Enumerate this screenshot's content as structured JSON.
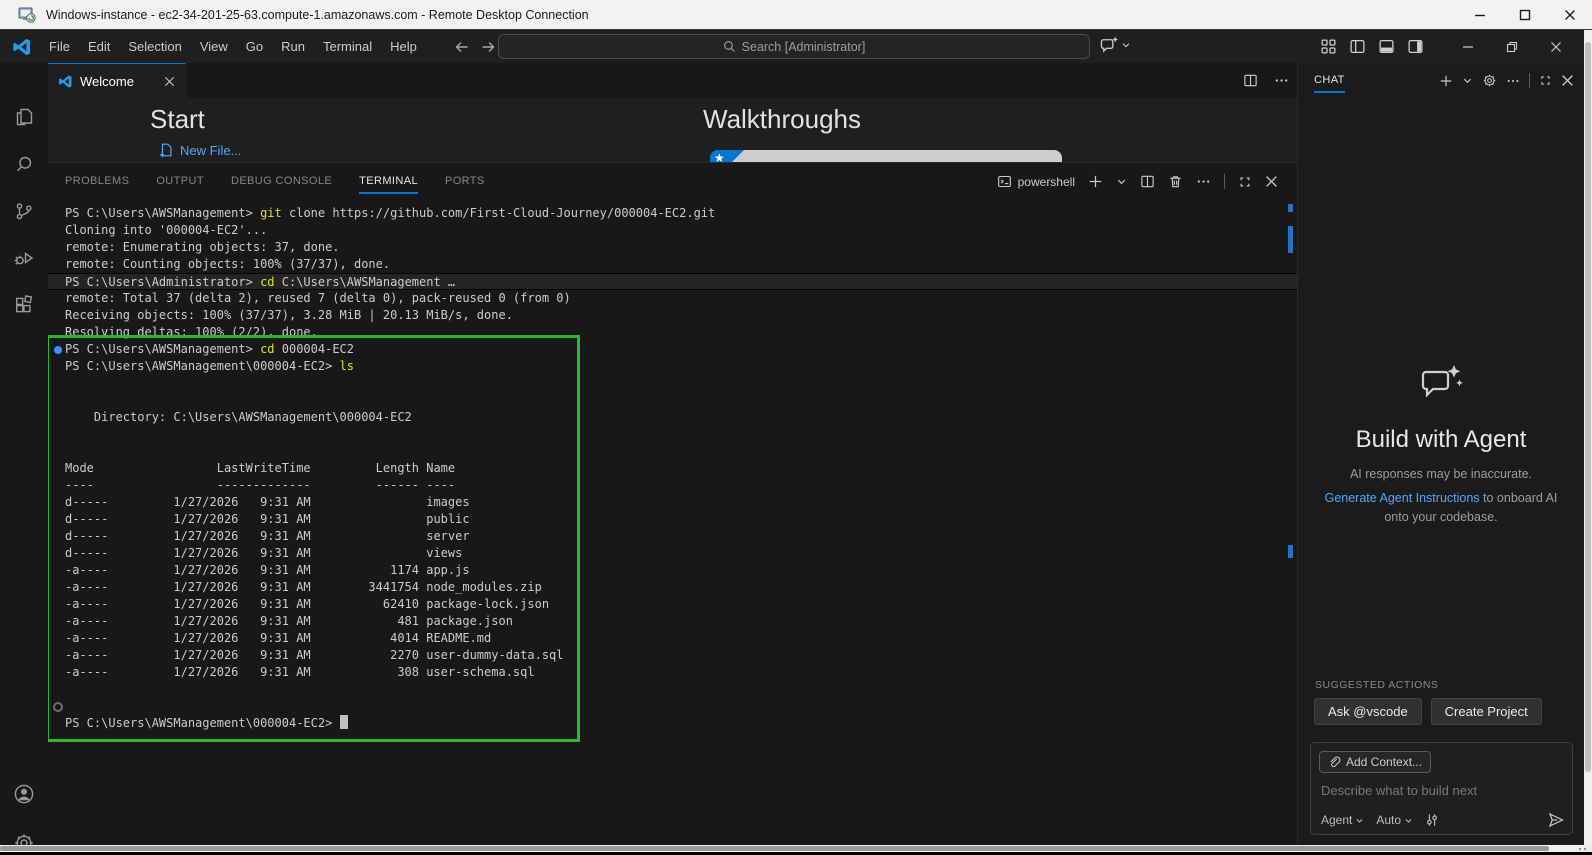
{
  "rdp": {
    "title": "Windows-instance - ec2-34-201-25-63.compute-1.amazonaws.com - Remote Desktop Connection"
  },
  "menubar": {
    "items": [
      "File",
      "Edit",
      "Selection",
      "View",
      "Go",
      "Run",
      "Terminal",
      "Help"
    ],
    "search_placeholder": "Search [Administrator]"
  },
  "editor": {
    "tab_label": "Welcome",
    "start_heading": "Start",
    "new_file_label": "New File...",
    "walkthroughs_heading": "Walkthroughs"
  },
  "panel": {
    "tabs": [
      "PROBLEMS",
      "OUTPUT",
      "DEBUG CONSOLE",
      "TERMINAL",
      "PORTS"
    ],
    "active_tab": "TERMINAL",
    "shell_label": "powershell"
  },
  "terminal": {
    "lines": [
      {
        "segs": [
          {
            "t": "PS C:\\Users\\AWSManagement> "
          },
          {
            "t": "git",
            "c": "y"
          },
          {
            "t": " clone https://github.com/First-Cloud-Journey/000004-EC2.git"
          }
        ]
      },
      {
        "segs": [
          {
            "t": "Cloning into '000004-EC2'..."
          }
        ]
      },
      {
        "segs": [
          {
            "t": "remote: Enumerating objects: 37, done."
          }
        ]
      },
      {
        "segs": [
          {
            "t": "remote: Counting objects: 100% (37/37), done."
          }
        ]
      },
      {
        "hl": true,
        "segs": [
          {
            "t": "PS C:\\Users\\Administrator> "
          },
          {
            "t": "cd",
            "c": "y"
          },
          {
            "t": " C:\\Users\\AWSManagement …"
          }
        ]
      },
      {
        "segs": [
          {
            "t": "remote: Total 37 (delta 2), reused 7 (delta 0), pack-reused 0 (from 0)"
          }
        ]
      },
      {
        "segs": [
          {
            "t": "Receiving objects: 100% (37/37), 3.28 MiB | 20.13 MiB/s, done."
          }
        ]
      },
      {
        "segs": [
          {
            "t": "Resolving deltas: 100% (2/2), done."
          }
        ]
      },
      {
        "dot": "blue",
        "segs": [
          {
            "t": "PS C:\\Users\\AWSManagement> "
          },
          {
            "t": "cd",
            "c": "y"
          },
          {
            "t": " 000004-EC2"
          }
        ]
      },
      {
        "segs": [
          {
            "t": "PS C:\\Users\\AWSManagement\\000004-EC2> "
          },
          {
            "t": "ls",
            "c": "y"
          }
        ]
      },
      {
        "segs": []
      },
      {
        "segs": []
      },
      {
        "segs": [
          {
            "t": "    Directory: C:\\Users\\AWSManagement\\000004-EC2"
          }
        ]
      },
      {
        "segs": []
      },
      {
        "segs": []
      },
      {
        "segs": [
          {
            "t": "Mode                 LastWriteTime         Length Name"
          }
        ]
      },
      {
        "segs": [
          {
            "t": "----                 -------------         ------ ----"
          }
        ]
      },
      {
        "segs": [
          {
            "t": "d-----         1/27/2026   9:31 AM                images"
          }
        ]
      },
      {
        "segs": [
          {
            "t": "d-----         1/27/2026   9:31 AM                public"
          }
        ]
      },
      {
        "segs": [
          {
            "t": "d-----         1/27/2026   9:31 AM                server"
          }
        ]
      },
      {
        "segs": [
          {
            "t": "d-----         1/27/2026   9:31 AM                views"
          }
        ]
      },
      {
        "segs": [
          {
            "t": "-a----         1/27/2026   9:31 AM           1174 app.js"
          }
        ]
      },
      {
        "segs": [
          {
            "t": "-a----         1/27/2026   9:31 AM        3441754 node_modules.zip"
          }
        ]
      },
      {
        "segs": [
          {
            "t": "-a----         1/27/2026   9:31 AM          62410 package-lock.json"
          }
        ]
      },
      {
        "segs": [
          {
            "t": "-a----         1/27/2026   9:31 AM            481 package.json"
          }
        ]
      },
      {
        "segs": [
          {
            "t": "-a----         1/27/2026   9:31 AM           4014 README.md"
          }
        ]
      },
      {
        "segs": [
          {
            "t": "-a----         1/27/2026   9:31 AM           2270 user-dummy-data.sql"
          }
        ]
      },
      {
        "segs": [
          {
            "t": "-a----         1/27/2026   9:31 AM            308 user-schema.sql"
          }
        ]
      },
      {
        "segs": []
      },
      {
        "dot": "ring",
        "segs": []
      },
      {
        "cursor": true,
        "segs": [
          {
            "t": "PS C:\\Users\\AWSManagement\\000004-EC2> "
          }
        ]
      }
    ]
  },
  "chat": {
    "header": "CHAT",
    "title": "Build with Agent",
    "disclaimer": "AI responses may be inaccurate.",
    "link_text": "Generate Agent Instructions",
    "link_suffix": " to onboard AI onto your codebase.",
    "suggested_heading": "SUGGESTED ACTIONS",
    "suggested_actions": [
      "Ask @vscode",
      "Create Project"
    ],
    "add_context_label": "Add Context...",
    "input_placeholder": "Describe what to build next",
    "mode_label": "Agent",
    "model_label": "Auto"
  },
  "colors": {
    "accent_blue": "#0078d4",
    "link_blue": "#4daafc",
    "terminal_yellow": "#e5e510",
    "highlight_green": "#2cb72c",
    "decoration_blue": "#3794ff",
    "ruler_blue": "#2472c8"
  }
}
